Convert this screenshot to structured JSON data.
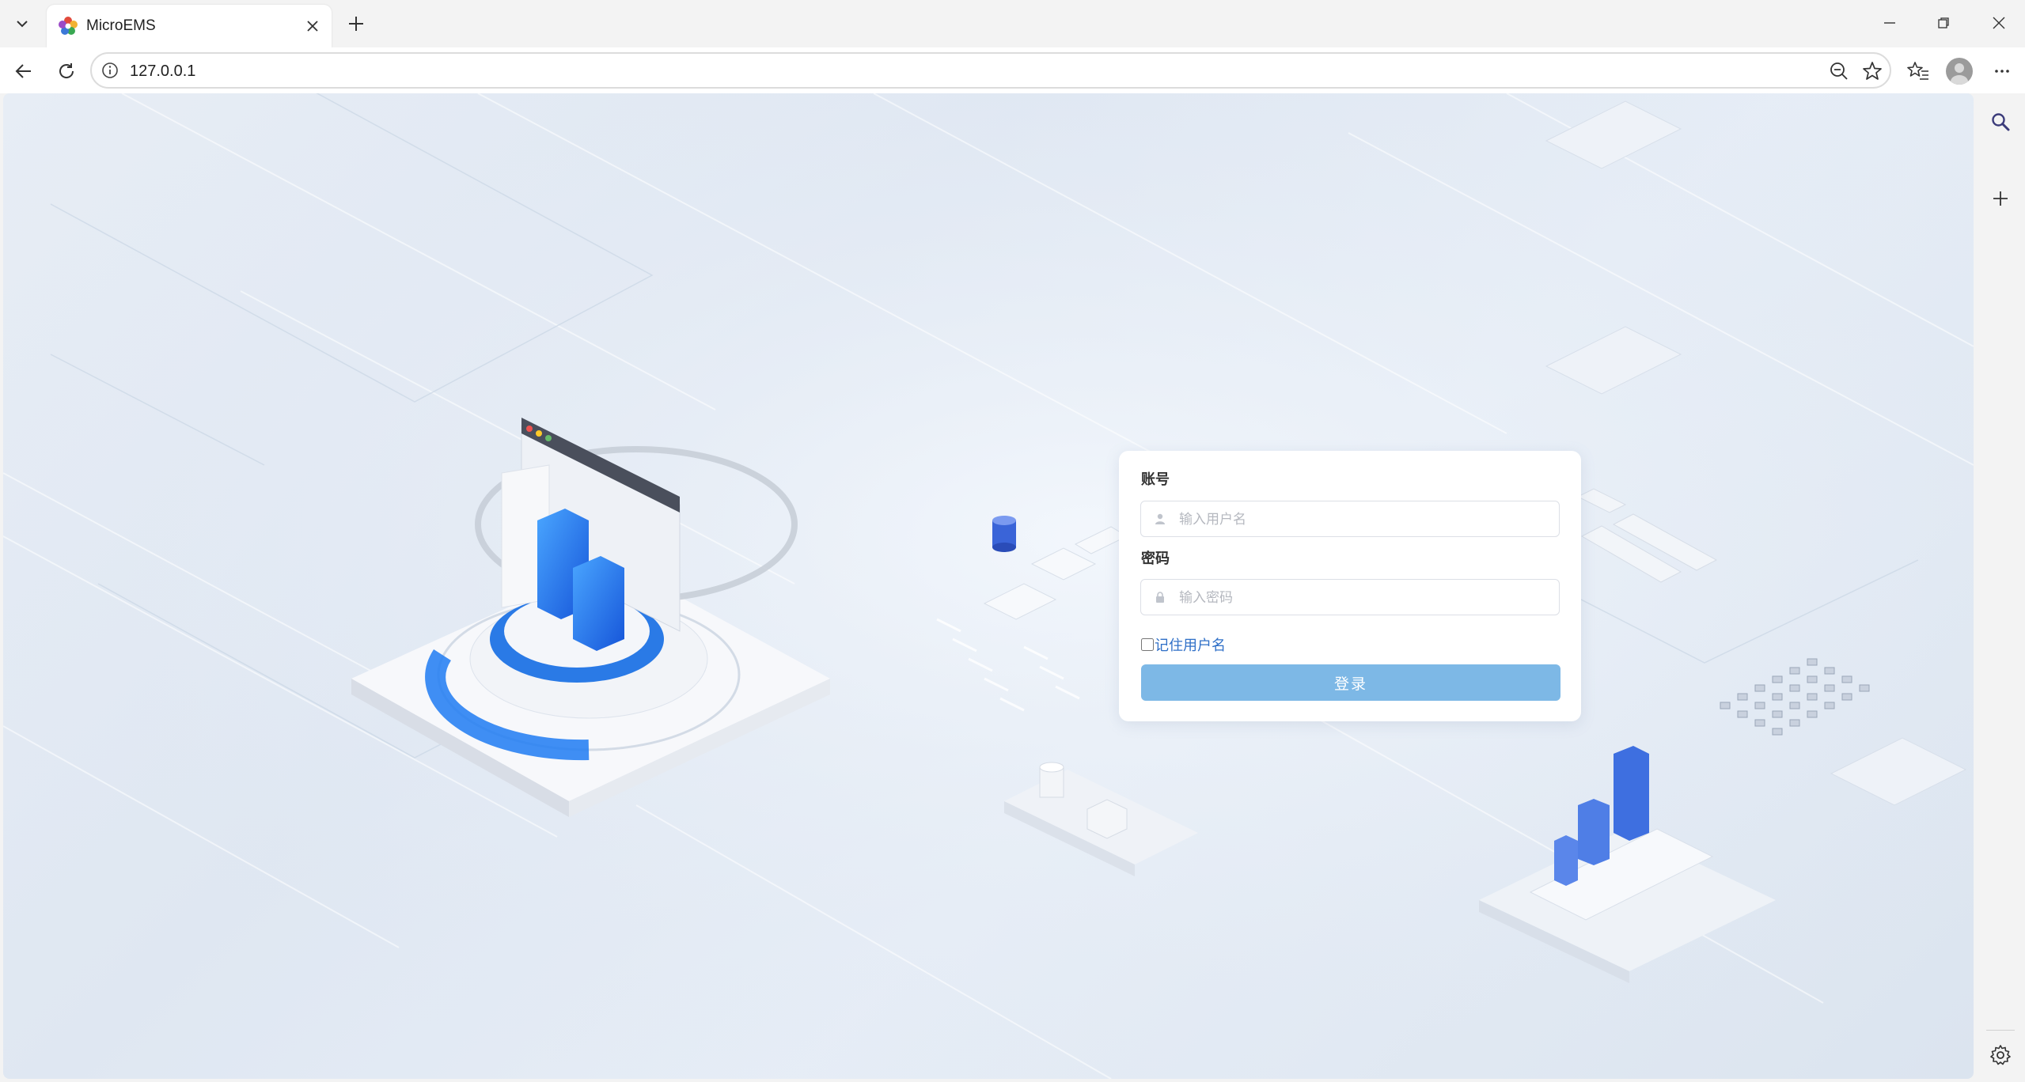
{
  "browser": {
    "tab_title": "MicroEMS",
    "url": "127.0.0.1"
  },
  "icons": {
    "tab_list": "chevron-down-icon",
    "favicon": "flower-icon",
    "tab_close": "close-icon",
    "new_tab": "plus-icon",
    "minimize": "minimize-icon",
    "restore": "restore-icon",
    "window_close": "close-icon",
    "back": "back-arrow-icon",
    "reload": "reload-icon",
    "site_info": "info-icon",
    "zoom": "zoom-out-icon",
    "favorite": "star-icon",
    "favorites": "favorites-list-icon",
    "profile": "profile-avatar-icon",
    "more": "more-icon",
    "sidebar_search": "search-icon",
    "sidebar_add": "plus-icon",
    "sidebar_settings": "gear-icon",
    "user_field": "user-icon",
    "password_field": "lock-icon"
  },
  "login": {
    "account_label": "账号",
    "username_placeholder": "输入用户名",
    "password_label": "密码",
    "password_placeholder": "输入密码",
    "remember_label": "记住用户名",
    "remember_checked": false,
    "submit_label": "登录"
  },
  "colors": {
    "accent_button": "#7db8e6",
    "link_text": "#2f6fc7",
    "background": "#e3eaf3"
  }
}
